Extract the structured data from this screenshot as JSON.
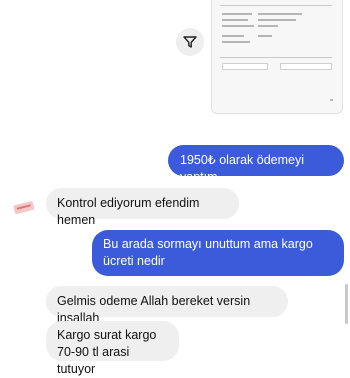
{
  "chat": {
    "messages": [
      {
        "direction": "outgoing",
        "text": "1950₺ olarak ödemeyi yaptım"
      },
      {
        "direction": "incoming",
        "text": "Kontrol ediyorum efendim hemen"
      },
      {
        "direction": "outgoing",
        "text": "Bu arada sormayı unuttum ama kargo ücreti nedir"
      },
      {
        "direction": "incoming",
        "text": "Gelmis odeme Allah bereket versin insallah"
      },
      {
        "direction": "incoming",
        "text": "Kargo surat kargo\n70-90 tl arasi tutuyor"
      }
    ]
  },
  "icons": {
    "filter": "filter-icon",
    "avatar": "seller-avatar-icon"
  },
  "colors": {
    "outgoing_bubble": "#3b5bdb",
    "incoming_bubble": "#efefef"
  }
}
